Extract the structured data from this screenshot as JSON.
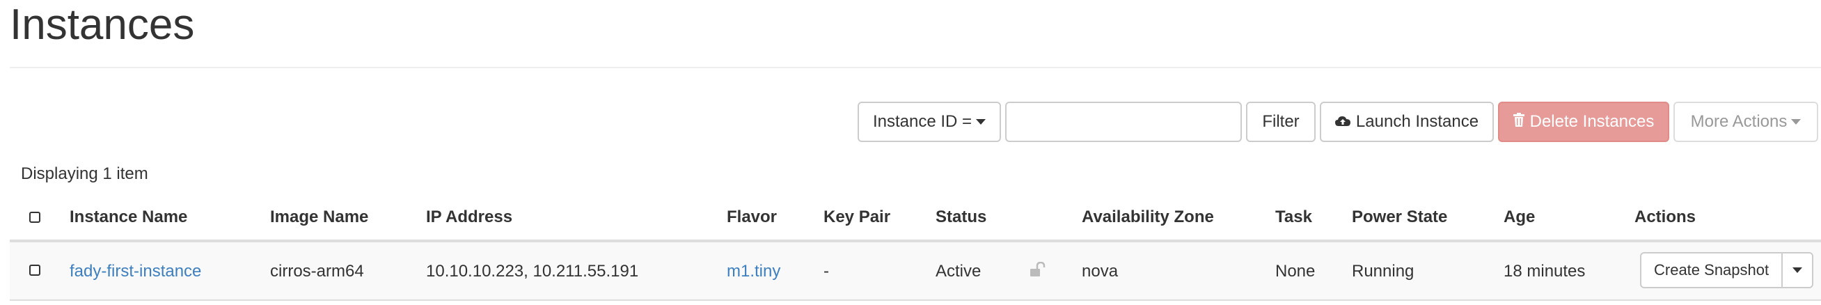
{
  "page": {
    "title": "Instances"
  },
  "toolbar": {
    "filter_field": "Instance ID =",
    "filter_input_value": "",
    "filter_button": "Filter",
    "launch_button": "Launch Instance",
    "delete_button": "Delete Instances",
    "more_actions": "More Actions"
  },
  "summary": {
    "count_text": "Displaying 1 item"
  },
  "table": {
    "columns": [
      "Instance Name",
      "Image Name",
      "IP Address",
      "Flavor",
      "Key Pair",
      "Status",
      "Availability Zone",
      "Task",
      "Power State",
      "Age",
      "Actions"
    ],
    "rows": [
      {
        "instance_name": "fady-first-instance",
        "image_name": "cirros-arm64",
        "ip_address": "10.10.10.223, 10.211.55.191",
        "flavor": "m1.tiny",
        "key_pair": "-",
        "status": "Active",
        "availability_zone": "nova",
        "task": "None",
        "power_state": "Running",
        "age": "18 minutes",
        "action_label": "Create Snapshot"
      }
    ]
  },
  "colors": {
    "link": "#3d7fbf",
    "danger": "#e79b99",
    "row_bg": "#f9f9f9"
  },
  "icons": {
    "launch": "cloud-upload-icon",
    "delete": "trash-icon",
    "lock": "unlock-icon"
  }
}
